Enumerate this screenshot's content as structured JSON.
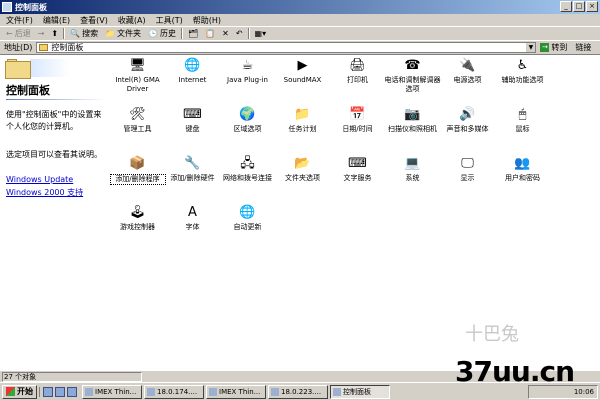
{
  "window": {
    "title": "控制面板",
    "controls": [
      "_",
      "□",
      "×"
    ]
  },
  "menu": [
    "文件(F)",
    "编辑(E)",
    "查看(V)",
    "收藏(A)",
    "工具(T)",
    "帮助(H)"
  ],
  "toolbar": {
    "back": "后退",
    "forward": "→",
    "search": "搜索",
    "folders": "文件夹",
    "history": "历史"
  },
  "address": {
    "label": "地址(D)",
    "value": "控制面板",
    "go": "转到",
    "links": "链接"
  },
  "left_pane": {
    "title": "控制面板",
    "description": "使用\"控制面板\"中的设置来个人化您的计算机。",
    "hint": "选定项目可以查看其说明。",
    "links": [
      "Windows Update",
      "Windows 2000 支持"
    ]
  },
  "items": [
    {
      "label": "Intel(R) GMA Driver",
      "icon": "monitor-icon",
      "glyph": "🖥"
    },
    {
      "label": "Internet",
      "icon": "globe-icon",
      "glyph": "🌐"
    },
    {
      "label": "Java Plug-in",
      "icon": "java-icon",
      "glyph": "☕"
    },
    {
      "label": "SoundMAX",
      "icon": "play-icon",
      "glyph": "▶"
    },
    {
      "label": "打印机",
      "icon": "printer-icon",
      "glyph": "🖨"
    },
    {
      "label": "电话和调制解调器选项",
      "icon": "phone-icon",
      "glyph": "☎"
    },
    {
      "label": "电源选项",
      "icon": "power-icon",
      "glyph": "🔌"
    },
    {
      "label": "辅助功能选项",
      "icon": "accessibility-icon",
      "glyph": "♿"
    },
    {
      "label": "管理工具",
      "icon": "tools-icon",
      "glyph": "🛠"
    },
    {
      "label": "键盘",
      "icon": "keyboard-icon",
      "glyph": "⌨"
    },
    {
      "label": "区域选项",
      "icon": "region-icon",
      "glyph": "🌍"
    },
    {
      "label": "任务计划",
      "icon": "task-icon",
      "glyph": "📁"
    },
    {
      "label": "日期/时间",
      "icon": "calendar-icon",
      "glyph": "📅"
    },
    {
      "label": "扫描仪和照相机",
      "icon": "scanner-icon",
      "glyph": "📷"
    },
    {
      "label": "声音和多媒体",
      "icon": "speaker-icon",
      "glyph": "🔊"
    },
    {
      "label": "鼠标",
      "icon": "mouse-icon",
      "glyph": "🖱"
    },
    {
      "label": "添加/删除程序",
      "icon": "programs-icon",
      "glyph": "📦"
    },
    {
      "label": "添加/删除硬件",
      "icon": "hardware-icon",
      "glyph": "🔧"
    },
    {
      "label": "网络和拨号连接",
      "icon": "network-icon",
      "glyph": "🖧"
    },
    {
      "label": "文件夹选项",
      "icon": "folder-icon",
      "glyph": "📂"
    },
    {
      "label": "文字服务",
      "icon": "text-services-icon",
      "glyph": "⌨"
    },
    {
      "label": "系统",
      "icon": "system-icon",
      "glyph": "💻"
    },
    {
      "label": "显示",
      "icon": "display-icon",
      "glyph": "🖵"
    },
    {
      "label": "用户和密码",
      "icon": "users-icon",
      "glyph": "👥"
    },
    {
      "label": "游戏控制器",
      "icon": "joystick-icon",
      "glyph": "🕹"
    },
    {
      "label": "字体",
      "icon": "fonts-icon",
      "glyph": "A"
    },
    {
      "label": "自动更新",
      "icon": "update-icon",
      "glyph": "🌐"
    }
  ],
  "selected_index": 16,
  "status": {
    "text": "27 个对象"
  },
  "taskbar": {
    "start": "开始",
    "tasks": [
      "IMEX Thin...",
      "18.0.174....",
      "IMEX Thin...",
      "18.0.223....",
      "控制面板"
    ],
    "active_task": 4,
    "clock": "10:06"
  },
  "watermark": {
    "text": "37uu.cn",
    "faint": "十巴兔"
  }
}
